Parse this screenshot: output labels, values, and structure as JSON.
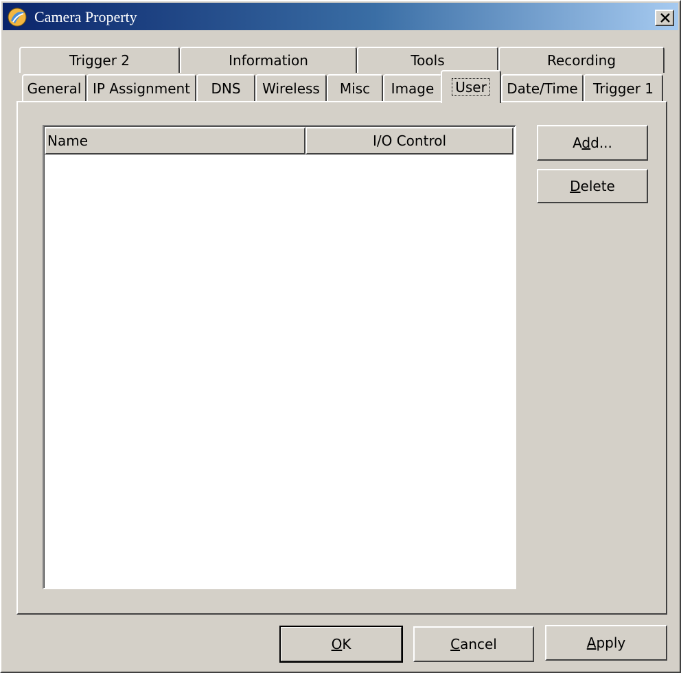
{
  "window": {
    "title": "Camera Property",
    "close_symbol": "×",
    "icon": "camera-app-icon"
  },
  "tabs": {
    "back_row": [
      {
        "label": "Trigger 2"
      },
      {
        "label": "Information"
      },
      {
        "label": "Tools"
      },
      {
        "label": "Recording"
      }
    ],
    "front_row": [
      {
        "label": "General"
      },
      {
        "label": "IP Assignment"
      },
      {
        "label": "DNS"
      },
      {
        "label": "Wireless"
      },
      {
        "label": "Misc"
      },
      {
        "label": "Image"
      },
      {
        "label": "User",
        "selected": true
      },
      {
        "label": "Date/Time"
      },
      {
        "label": "Trigger 1"
      }
    ]
  },
  "user_list": {
    "columns": [
      "Name",
      "I/O Control"
    ],
    "rows": []
  },
  "side_buttons": {
    "add": {
      "label": "Add...",
      "access_key": "d"
    },
    "delete": {
      "label": "Delete",
      "access_key": "D"
    }
  },
  "footer_buttons": {
    "ok": {
      "label": "OK",
      "access_key": "O"
    },
    "cancel": {
      "label": "Cancel",
      "access_key": "C"
    },
    "apply": {
      "label": "Apply",
      "access_key": "A"
    }
  },
  "colors": {
    "face": "#d4d0c8",
    "title_start": "#0a246a",
    "title_end": "#a6caf0",
    "list_background": "#ffffff"
  }
}
